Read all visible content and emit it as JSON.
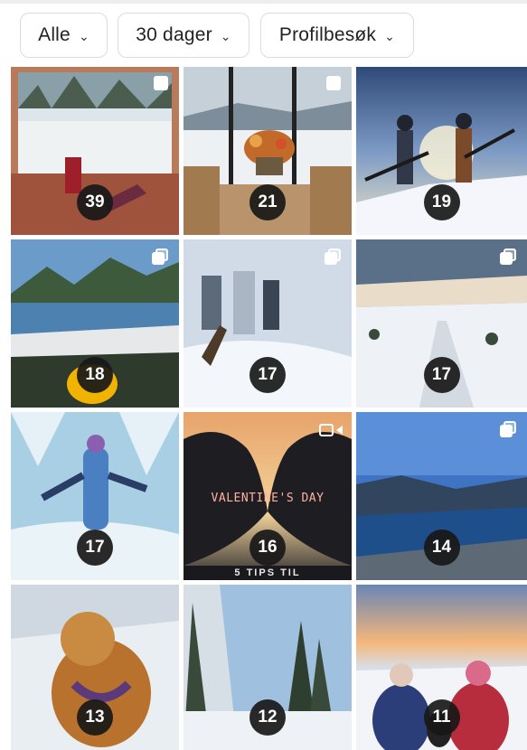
{
  "filters": {
    "type": "Alle",
    "period": "30 dager",
    "metric": "Profilbesøk"
  },
  "posts": [
    {
      "count": "39",
      "media": "single",
      "scene": "snowy-window-indoor"
    },
    {
      "count": "21",
      "media": "single",
      "scene": "flowers-table-window"
    },
    {
      "count": "19",
      "media": "single",
      "scene": "skiers-summit-sunset"
    },
    {
      "count": "18",
      "media": "carousel",
      "scene": "lake-mountains"
    },
    {
      "count": "17",
      "media": "carousel",
      "scene": "snowstorm-hikers"
    },
    {
      "count": "17",
      "media": "carousel",
      "scene": "snow-road-dusk"
    },
    {
      "count": "17",
      "media": "single",
      "scene": "person-snow-arms-out"
    },
    {
      "count": "16",
      "media": "video",
      "scene": "heart-hands",
      "overlay_text": "VALENTINE'S DAY",
      "caption_partial": "5 TIPS TIL"
    },
    {
      "count": "14",
      "media": "carousel",
      "scene": "fjord-valley"
    },
    {
      "count": "13",
      "media": "single",
      "scene": "dog-in-snow"
    },
    {
      "count": "12",
      "media": "single",
      "scene": "snowy-forest-trees"
    },
    {
      "count": "11",
      "media": "single",
      "scene": "couple-dog-sunset-view"
    }
  ],
  "icons": {
    "chevron": "chevron-down-icon",
    "carousel": "carousel-icon",
    "single": "photo-icon",
    "video": "video-icon"
  }
}
